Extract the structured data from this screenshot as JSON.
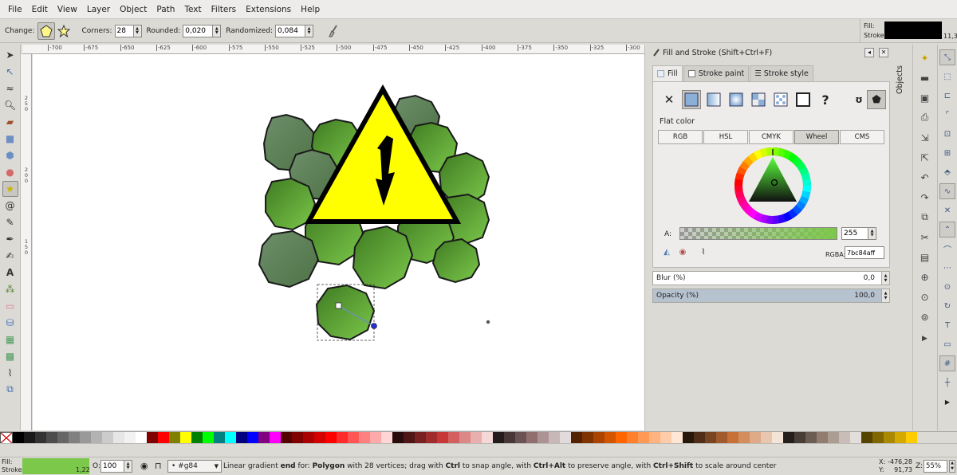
{
  "menu": [
    "File",
    "Edit",
    "View",
    "Layer",
    "Object",
    "Path",
    "Text",
    "Filters",
    "Extensions",
    "Help"
  ],
  "controls": {
    "change_label": "Change:",
    "corners_label": "Corners:",
    "corners_value": "28",
    "rounded_label": "Rounded:",
    "rounded_value": "0,020",
    "randomized_label": "Randomized:",
    "randomized_value": "0,084"
  },
  "indicator": {
    "fill_label": "Fill:",
    "stroke_label": "Stroke:",
    "stroke_width": "11,3",
    "fill_color": "#000000"
  },
  "ruler_ticks": [
    "-700",
    "-675",
    "-650",
    "-625",
    "-600",
    "-575",
    "-550",
    "-525",
    "-500",
    "-475",
    "-450",
    "-425",
    "-400",
    "-375",
    "-350",
    "-325",
    "-300"
  ],
  "vruler_ticks": [
    "2",
    "5",
    "0",
    "2",
    "0",
    "0",
    "1",
    "5",
    "0"
  ],
  "dock": {
    "title": "Fill and Stroke (Shift+Ctrl+F)",
    "tabs": [
      "Fill",
      "Stroke paint",
      "Stroke style"
    ],
    "flat_color_label": "Flat color",
    "modes": [
      "RGB",
      "HSL",
      "CMYK",
      "Wheel",
      "CMS"
    ],
    "alpha_label": "A:",
    "alpha_value": "255",
    "rgba_label": "RGBA:",
    "rgba_value": "7bc84aff",
    "blur_label": "Blur (%)",
    "blur_value": "0,0",
    "opacity_label": "Opacity (%)",
    "opacity_value": "100,0",
    "objects_label": "Objects"
  },
  "status": {
    "fill_label": "Fill:",
    "stroke_label": "Stroke:",
    "stroke_width": "1,22",
    "fill_color": "#7bc84a",
    "opacity_label": "O:",
    "opacity_value": "100",
    "layer_name": "#g84",
    "message_parts": [
      {
        "t": "Linear gradient ",
        "b": false
      },
      {
        "t": "end",
        "b": true
      },
      {
        "t": " for: ",
        "b": false
      },
      {
        "t": "Polygon",
        "b": true
      },
      {
        "t": " with 28 vertices; drag with ",
        "b": false
      },
      {
        "t": "Ctrl",
        "b": true
      },
      {
        "t": " to snap angle, with ",
        "b": false
      },
      {
        "t": "Ctrl+Alt",
        "b": true
      },
      {
        "t": " to preserve angle, with ",
        "b": false
      },
      {
        "t": "Ctrl+Shift",
        "b": true
      },
      {
        "t": " to scale around center",
        "b": false
      }
    ],
    "x_label": "X:",
    "x_value": "-476,28",
    "y_label": "Y:",
    "y_value": "91,73",
    "zoom_label": "Z:",
    "zoom_value": "55%"
  },
  "palette": [
    "#000000",
    "#1a1a1a",
    "#333333",
    "#4d4d4d",
    "#666666",
    "#808080",
    "#999999",
    "#b3b3b3",
    "#cccccc",
    "#e6e6e6",
    "#f2f2f2",
    "#ffffff",
    "#800000",
    "#ff0000",
    "#808000",
    "#ffff00",
    "#008000",
    "#00ff00",
    "#008080",
    "#00ffff",
    "#000080",
    "#0000ff",
    "#800080",
    "#ff00ff",
    "#550000",
    "#800000",
    "#aa0000",
    "#d40000",
    "#ff0000",
    "#ff2a2a",
    "#ff5555",
    "#ff8080",
    "#ffaaaa",
    "#ffd5d5",
    "#280b0b",
    "#501616",
    "#782121",
    "#a02c2c",
    "#c83737",
    "#d35f5f",
    "#de8787",
    "#e9afaf",
    "#f4d7d7",
    "#241c1c",
    "#483737",
    "#6c5353",
    "#916f6f",
    "#ac9393",
    "#c8b7b7",
    "#e3dbdb",
    "#552200",
    "#803300",
    "#aa4400",
    "#d45500",
    "#ff6600",
    "#ff7f2a",
    "#ff9955",
    "#ffb380",
    "#ffccaa",
    "#ffe6d5",
    "#28170b",
    "#502d16",
    "#784421",
    "#a05a2c",
    "#c87137",
    "#d38d5f",
    "#deaa87",
    "#e9c6af",
    "#f4e3d7",
    "#241f1c",
    "#483e37",
    "#6c5d53",
    "#917c6f",
    "#ac9d93",
    "#c8beb7",
    "#e3dedb",
    "#554400",
    "#806600",
    "#aa8800",
    "#d4aa00",
    "#ffcc00"
  ]
}
